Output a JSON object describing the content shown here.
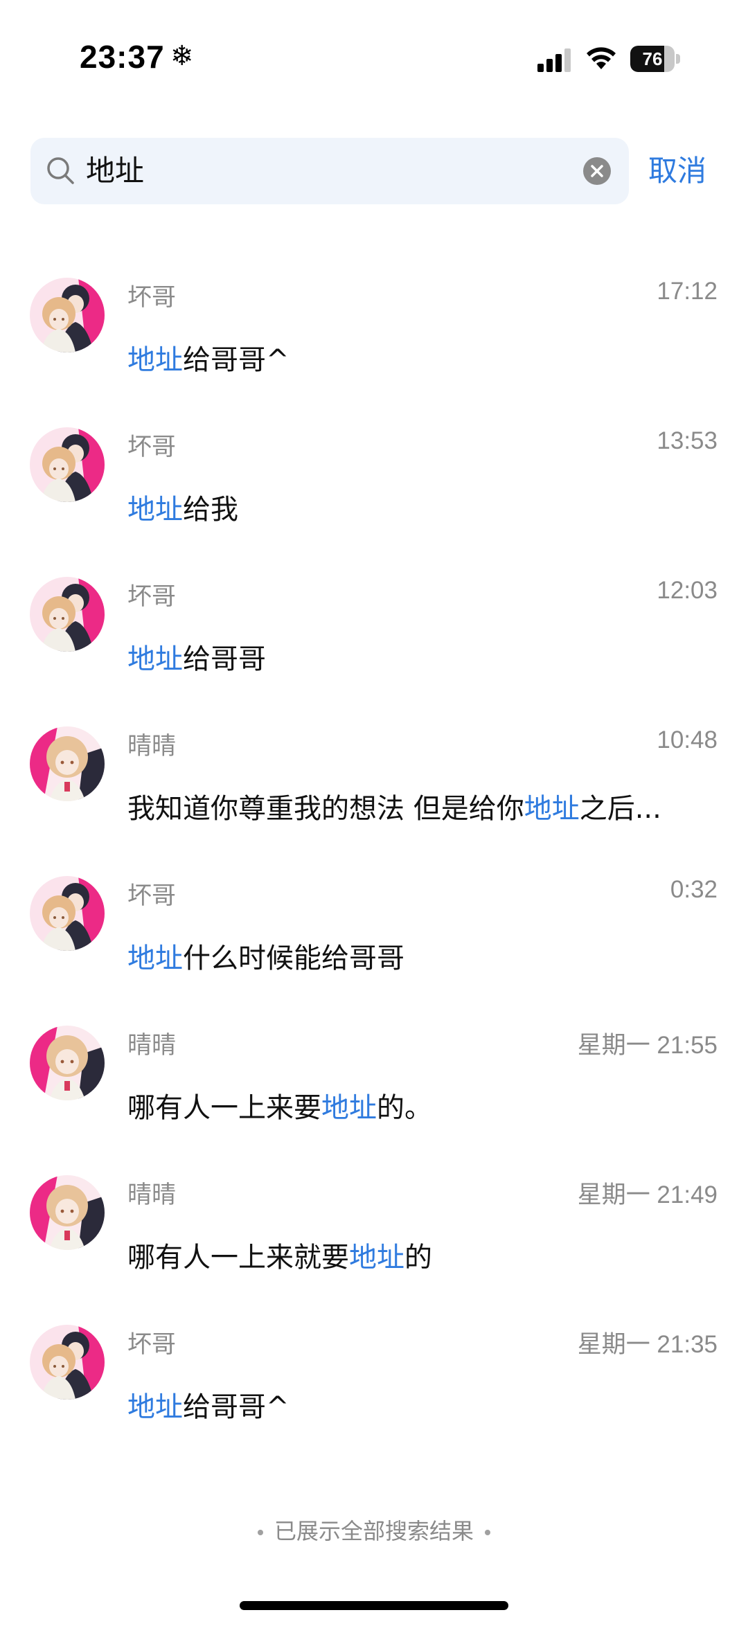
{
  "status_bar": {
    "time": "23:37",
    "battery": "76",
    "battery_level": 0.76
  },
  "search": {
    "query": "地址",
    "cancel_label": "取消"
  },
  "results": [
    {
      "name": "坏哥",
      "time": "17:12",
      "before": "",
      "highlight": "地址",
      "after": "给哥哥^",
      "avatar": "couple"
    },
    {
      "name": "坏哥",
      "time": "13:53",
      "before": "",
      "highlight": "地址",
      "after": "给我",
      "avatar": "couple"
    },
    {
      "name": "坏哥",
      "time": "12:03",
      "before": "",
      "highlight": "地址",
      "after": "给哥哥",
      "avatar": "couple"
    },
    {
      "name": "晴晴",
      "time": "10:48",
      "before": "我知道你尊重我的想法 但是给你",
      "highlight": "地址",
      "after": "之后...",
      "avatar": "girl"
    },
    {
      "name": "坏哥",
      "time": "0:32",
      "before": "",
      "highlight": "地址",
      "after": "什么时候能给哥哥",
      "avatar": "couple"
    },
    {
      "name": "晴晴",
      "time": "星期一 21:55",
      "before": "哪有人一上来要",
      "highlight": "地址",
      "after": "的。",
      "avatar": "girl"
    },
    {
      "name": "晴晴",
      "time": "星期一 21:49",
      "before": "哪有人一上来就要",
      "highlight": "地址",
      "after": "的",
      "avatar": "girl"
    },
    {
      "name": "坏哥",
      "time": "星期一 21:35",
      "before": "",
      "highlight": "地址",
      "after": "给哥哥^",
      "avatar": "couple"
    }
  ],
  "footer": {
    "note": "已展示全部搜索结果"
  },
  "colors": {
    "accent": "#2f7bdf",
    "search_bg": "#eff4fb",
    "secondary_text": "#8a8a8a",
    "avatar_pink": "#ec2a86"
  }
}
